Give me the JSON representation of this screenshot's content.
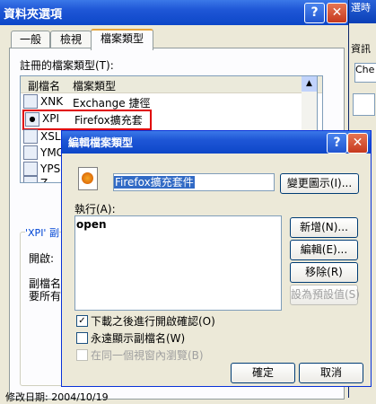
{
  "bg_window": {
    "title_fragment": "選時",
    "label_fragment": "資訊",
    "input_fragment": "Che"
  },
  "folder_options": {
    "title": "資料夾選項",
    "tabs": [
      {
        "label": "一般"
      },
      {
        "label": "檢視"
      },
      {
        "label": "檔案類型"
      }
    ],
    "registered_label": "註冊的檔案類型(T):",
    "columns": [
      "副檔名",
      "檔案類型"
    ],
    "rows": [
      {
        "ext": "XNK",
        "type": "Exchange 捷徑"
      },
      {
        "ext": "XPI",
        "type": "Firefox擴充套件"
      },
      {
        "ext": "XSL",
        "type": ""
      },
      {
        "ext": "YMG",
        "type": ""
      },
      {
        "ext": "YPS",
        "type": ""
      },
      {
        "ext": "Z",
        "type": ""
      }
    ],
    "details_title_fragment": "'XPI' 副",
    "opens_with_fragment": "開啟:",
    "desc_fragment_1": "副檔名",
    "desc_fragment_2": "要所有",
    "bottom_fragment": "修改日期: 2004/10/19"
  },
  "edit_dialog": {
    "title": "編輯檔案類型",
    "name_value": "Firefox擴充套件",
    "change_icon_label": "變更圖示(I)...",
    "actions_label": "執行(A):",
    "actions": [
      "open"
    ],
    "new_label": "新增(N)...",
    "edit_label": "編輯(E)...",
    "remove_label": "移除(R)",
    "set_default_label": "設為預設值(S)",
    "checkboxes": [
      {
        "label": "下載之後進行開啟確認(O)",
        "checked": true,
        "enabled": true
      },
      {
        "label": "永遠顯示副檔名(W)",
        "checked": false,
        "enabled": true
      },
      {
        "label": "在同一個視窗內瀏覽(B)",
        "checked": false,
        "enabled": false
      }
    ],
    "ok_label": "確定",
    "cancel_label": "取消"
  },
  "colors": {
    "title_blue": "#0d47c8",
    "highlight_red": "#e00000",
    "selection_blue": "#316ac5"
  }
}
